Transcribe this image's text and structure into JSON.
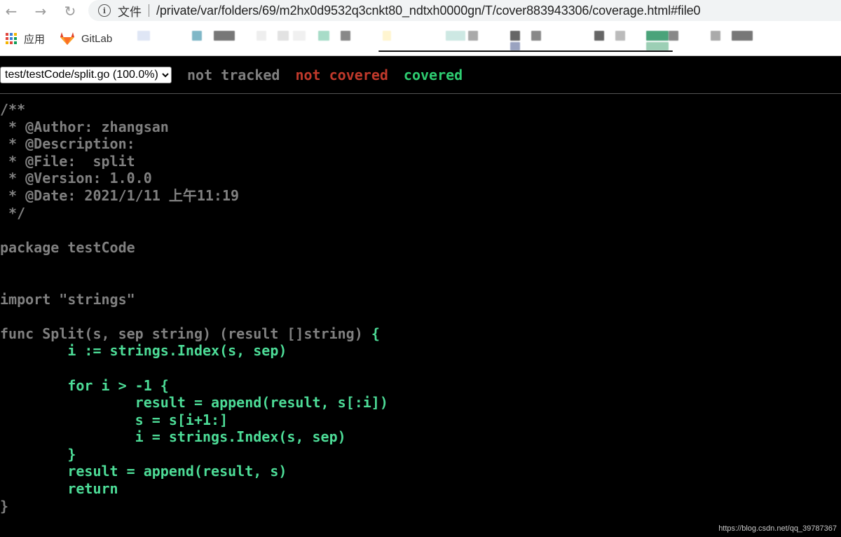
{
  "browser": {
    "back_icon": "back-arrow-icon",
    "forward_icon": "forward-arrow-icon",
    "reload_icon": "reload-icon",
    "info_icon": "info-icon",
    "scheme_label": "文件",
    "url": "/private/var/folders/69/m2hx0d9532q3cnkt80_ndtxh0000gn/T/cover883943306/coverage.html#file0",
    "bookmarks": [
      {
        "label": "应用",
        "icon": "apps-grid-icon"
      },
      {
        "label": "GitLab",
        "icon": "gitlab-icon"
      }
    ]
  },
  "coverage": {
    "selected_file": "test/testCode/split.go (100.0%)",
    "legend": {
      "not_tracked": "not tracked",
      "not_covered": "not covered",
      "covered": "covered"
    },
    "colors": {
      "not_tracked": "#808080",
      "not_covered": "#c0392b",
      "covered": "#4ddc97",
      "background": "#000000"
    },
    "lines": [
      {
        "text": "/**",
        "status": "nottracked"
      },
      {
        "text": " * @Author: zhangsan",
        "status": "nottracked"
      },
      {
        "text": " * @Description:",
        "status": "nottracked"
      },
      {
        "text": " * @File:  split",
        "status": "nottracked"
      },
      {
        "text": " * @Version: 1.0.0",
        "status": "nottracked"
      },
      {
        "text": " * @Date: 2021/1/11 上午11:19",
        "status": "nottracked"
      },
      {
        "text": " */",
        "status": "nottracked"
      },
      {
        "text": "",
        "status": "nottracked"
      },
      {
        "text": "package testCode",
        "status": "nottracked"
      },
      {
        "text": "",
        "status": "nottracked"
      },
      {
        "text": "",
        "status": "nottracked"
      },
      {
        "text": "import \"strings\"",
        "status": "nottracked"
      },
      {
        "text": "",
        "status": "nottracked"
      },
      {
        "text": "func Split(s, sep string) (result []string) {",
        "status": "mixed",
        "tracked_part": "func Split(s, sep string) (result []string) ",
        "covered_part": "{"
      },
      {
        "text": "        i := strings.Index(s, sep)",
        "status": "covered"
      },
      {
        "text": "",
        "status": "nottracked"
      },
      {
        "text": "        for i > -1 {",
        "status": "covered"
      },
      {
        "text": "                result = append(result, s[:i])",
        "status": "covered"
      },
      {
        "text": "                s = s[i+1:]",
        "status": "covered"
      },
      {
        "text": "                i = strings.Index(s, sep)",
        "status": "covered"
      },
      {
        "text": "        }",
        "status": "covered"
      },
      {
        "text": "        result = append(result, s)",
        "status": "covered"
      },
      {
        "text": "        return",
        "status": "covered"
      },
      {
        "text": "}",
        "status": "nottracked"
      }
    ]
  },
  "watermark": "https://blog.csdn.net/qq_39787367"
}
